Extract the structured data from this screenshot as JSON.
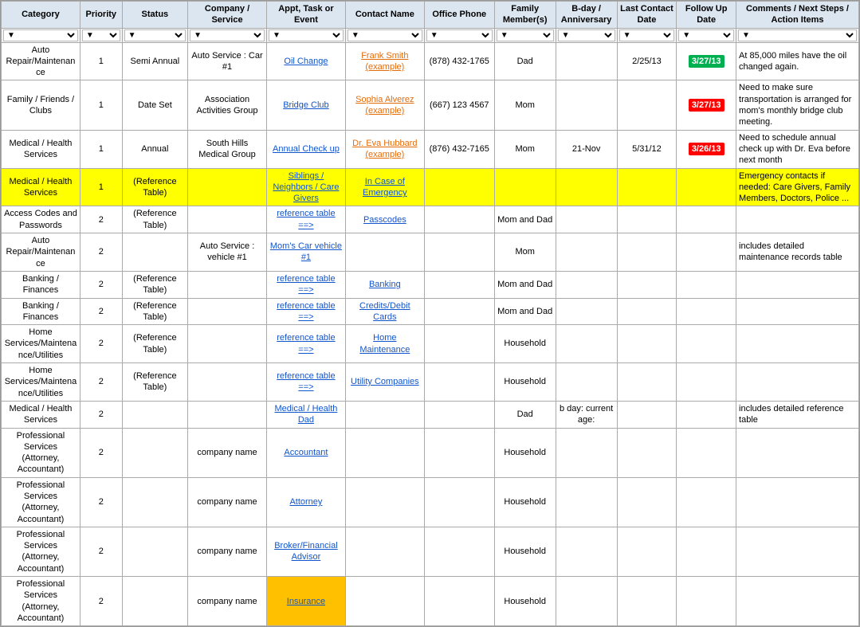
{
  "headers": [
    "Category",
    "Priority",
    "Status",
    "Company / Service",
    "Appt, Task or Event",
    "Contact Name",
    "Office Phone",
    "Family Member(s)",
    "B-day / Anniversary",
    "Last Contact Date",
    "Follow Up Date",
    "Comments / Next Steps / Action Items"
  ],
  "rows": [
    {
      "category": "Auto Repair/Maintenance",
      "priority": "1",
      "status": "Semi Annual",
      "company": "Auto Service : Car #1",
      "appt": "Oil Change",
      "appt_link": true,
      "contact": "Frank Smith (example)",
      "contact_link": true,
      "contact_color": "orange",
      "phone": "(878) 432-1765",
      "family": "Dad",
      "bday": "",
      "last_contact": "2/25/13",
      "follow_up": "3/27/13",
      "follow_up_style": "green",
      "comments": "At 85,000 miles have the oil changed again.",
      "row_style": ""
    },
    {
      "category": "Family / Friends / Clubs",
      "priority": "1",
      "status": "Date Set",
      "company": "Association Activities Group",
      "appt": "Bridge Club",
      "appt_link": true,
      "contact": "Sophia Alverez (example)",
      "contact_link": true,
      "contact_color": "orange",
      "phone": "(667) 123 4567",
      "family": "Mom",
      "bday": "",
      "last_contact": "",
      "follow_up": "3/27/13",
      "follow_up_style": "red",
      "comments": "Need to make sure transportation is arranged for mom's monthly bridge club meeting.",
      "row_style": ""
    },
    {
      "category": "Medical / Health Services",
      "priority": "1",
      "status": "Annual",
      "company": "South Hills Medical Group",
      "appt": "Annual Check up",
      "appt_link": true,
      "contact": "Dr. Eva Hubbard (example)",
      "contact_link": true,
      "contact_color": "orange",
      "phone": "(876) 432-7165",
      "family": "Mom",
      "bday": "21-Nov",
      "last_contact": "5/31/12",
      "follow_up": "3/26/13",
      "follow_up_style": "red",
      "comments": "Need to schedule annual check up with Dr. Eva before next month",
      "row_style": ""
    },
    {
      "category": "Medical / Health Services",
      "priority": "1",
      "status": "(Reference Table)",
      "company": "",
      "appt": "Siblings / Neighbors / Care Givers",
      "appt_link": true,
      "contact": "In Case of Emergency",
      "contact_link": true,
      "contact_color": "blue",
      "phone": "",
      "family": "",
      "bday": "",
      "last_contact": "",
      "follow_up": "",
      "follow_up_style": "",
      "comments": "Emergency contacts if needed: Care Givers, Family Members, Doctors, Police ...",
      "row_style": "yellow"
    },
    {
      "category": "Access Codes and Passwords",
      "priority": "2",
      "status": "(Reference Table)",
      "company": "",
      "appt": "reference table ==>",
      "appt_link": true,
      "contact": "Passcodes",
      "contact_link": true,
      "contact_color": "blue",
      "phone": "",
      "family": "Mom and Dad",
      "bday": "",
      "last_contact": "",
      "follow_up": "",
      "follow_up_style": "",
      "comments": "",
      "row_style": ""
    },
    {
      "category": "Auto Repair/Maintenance",
      "priority": "2",
      "status": "",
      "company": "Auto Service : vehicle #1",
      "appt": "Mom's Car vehicle #1",
      "appt_link": true,
      "contact": "",
      "contact_link": false,
      "contact_color": "blue",
      "phone": "",
      "family": "Mom",
      "bday": "",
      "last_contact": "",
      "follow_up": "",
      "follow_up_style": "",
      "comments": "includes detailed maintenance records table",
      "row_style": ""
    },
    {
      "category": "Banking / Finances",
      "priority": "2",
      "status": "(Reference Table)",
      "company": "",
      "appt": "reference table ==>",
      "appt_link": true,
      "contact": "Banking",
      "contact_link": true,
      "contact_color": "blue",
      "phone": "",
      "family": "Mom and Dad",
      "bday": "",
      "last_contact": "",
      "follow_up": "",
      "follow_up_style": "",
      "comments": "",
      "row_style": ""
    },
    {
      "category": "Banking / Finances",
      "priority": "2",
      "status": "(Reference Table)",
      "company": "",
      "appt": "reference table ==>",
      "appt_link": true,
      "contact": "Credits/Debit Cards",
      "contact_link": true,
      "contact_color": "blue",
      "phone": "",
      "family": "Mom and Dad",
      "bday": "",
      "last_contact": "",
      "follow_up": "",
      "follow_up_style": "",
      "comments": "",
      "row_style": ""
    },
    {
      "category": "Home Services/Maintenance/Utilities",
      "priority": "2",
      "status": "(Reference Table)",
      "company": "",
      "appt": "reference table ==>",
      "appt_link": true,
      "contact": "Home Maintenance",
      "contact_link": true,
      "contact_color": "blue",
      "phone": "",
      "family": "Household",
      "bday": "",
      "last_contact": "",
      "follow_up": "",
      "follow_up_style": "",
      "comments": "",
      "row_style": ""
    },
    {
      "category": "Home Services/Maintenance/Utilities",
      "priority": "2",
      "status": "(Reference Table)",
      "company": "",
      "appt": "reference table ==>",
      "appt_link": true,
      "contact": "Utility Companies",
      "contact_link": true,
      "contact_color": "blue",
      "phone": "",
      "family": "Household",
      "bday": "",
      "last_contact": "",
      "follow_up": "",
      "follow_up_style": "",
      "comments": "",
      "row_style": ""
    },
    {
      "category": "Medical / Health Services",
      "priority": "2",
      "status": "",
      "company": "",
      "appt": "Medical / Health Dad",
      "appt_link": true,
      "contact": "",
      "contact_link": false,
      "contact_color": "blue",
      "phone": "",
      "family": "Dad",
      "bday": "b day: current age:",
      "last_contact": "",
      "follow_up": "",
      "follow_up_style": "",
      "comments": "includes detailed reference table",
      "row_style": ""
    },
    {
      "category": "Professional Services (Attorney, Accountant)",
      "priority": "2",
      "status": "",
      "company": "company name",
      "appt": "Accountant",
      "appt_link": true,
      "contact": "",
      "contact_link": false,
      "contact_color": "blue",
      "phone": "",
      "family": "Household",
      "bday": "",
      "last_contact": "",
      "follow_up": "",
      "follow_up_style": "",
      "comments": "",
      "row_style": ""
    },
    {
      "category": "Professional Services (Attorney, Accountant)",
      "priority": "2",
      "status": "",
      "company": "company name",
      "appt": "Attorney",
      "appt_link": true,
      "contact": "",
      "contact_link": false,
      "contact_color": "blue",
      "phone": "",
      "family": "Household",
      "bday": "",
      "last_contact": "",
      "follow_up": "",
      "follow_up_style": "",
      "comments": "",
      "row_style": ""
    },
    {
      "category": "Professional Services (Attorney, Accountant)",
      "priority": "2",
      "status": "",
      "company": "company name",
      "appt": "Broker/Financial Advisor",
      "appt_link": true,
      "contact": "",
      "contact_link": false,
      "contact_color": "blue",
      "phone": "",
      "family": "Household",
      "bday": "",
      "last_contact": "",
      "follow_up": "",
      "follow_up_style": "",
      "comments": "",
      "row_style": ""
    },
    {
      "category": "Professional Services (Attorney, Accountant)",
      "priority": "2",
      "status": "",
      "company": "company name",
      "appt": "Insurance",
      "appt_link": true,
      "appt_bg": "orange",
      "contact": "",
      "contact_link": false,
      "contact_color": "blue",
      "phone": "",
      "family": "Household",
      "bday": "",
      "last_contact": "",
      "follow_up": "",
      "follow_up_style": "",
      "comments": "",
      "row_style": ""
    }
  ]
}
